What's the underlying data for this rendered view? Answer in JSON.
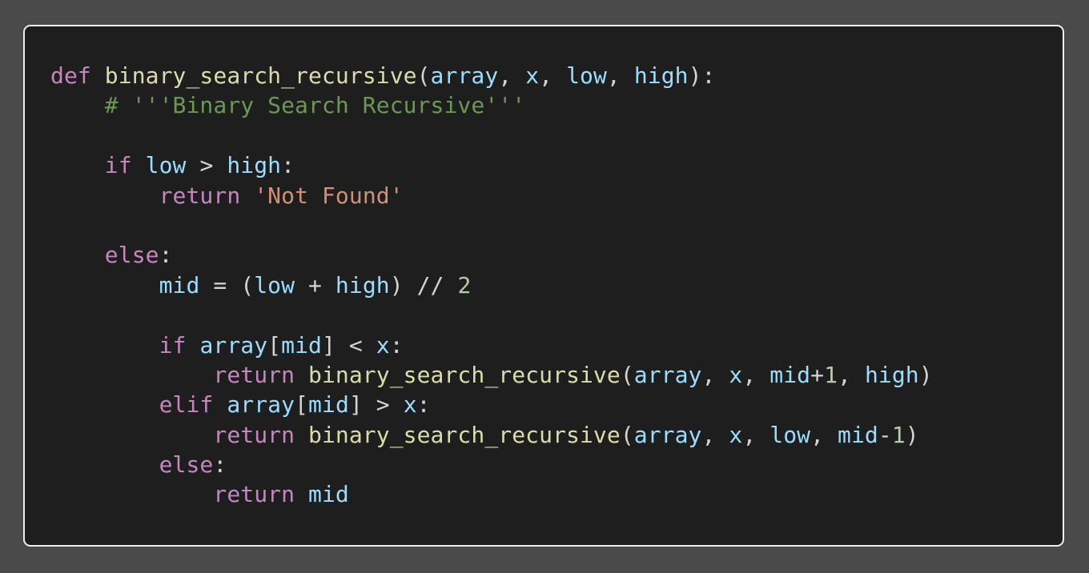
{
  "code": {
    "language": "python",
    "lines": [
      [
        [
          "kw",
          "def"
        ],
        [
          "pn",
          " "
        ],
        [
          "fn",
          "binary_search_recursive"
        ],
        [
          "pn",
          "("
        ],
        [
          "var",
          "array"
        ],
        [
          "pn",
          ", "
        ],
        [
          "var",
          "x"
        ],
        [
          "pn",
          ", "
        ],
        [
          "var",
          "low"
        ],
        [
          "pn",
          ", "
        ],
        [
          "var",
          "high"
        ],
        [
          "pn",
          "):"
        ]
      ],
      [
        [
          "pn",
          "    "
        ],
        [
          "cm",
          "# '''Binary Search Recursive'''"
        ]
      ],
      [],
      [
        [
          "pn",
          "    "
        ],
        [
          "kw",
          "if"
        ],
        [
          "pn",
          " "
        ],
        [
          "var",
          "low"
        ],
        [
          "pn",
          " > "
        ],
        [
          "var",
          "high"
        ],
        [
          "pn",
          ":"
        ]
      ],
      [
        [
          "pn",
          "        "
        ],
        [
          "kw",
          "return"
        ],
        [
          "pn",
          " "
        ],
        [
          "str",
          "'Not Found'"
        ]
      ],
      [],
      [
        [
          "pn",
          "    "
        ],
        [
          "kw",
          "else"
        ],
        [
          "pn",
          ":"
        ]
      ],
      [
        [
          "pn",
          "        "
        ],
        [
          "var",
          "mid"
        ],
        [
          "pn",
          " = ("
        ],
        [
          "var",
          "low"
        ],
        [
          "pn",
          " + "
        ],
        [
          "var",
          "high"
        ],
        [
          "pn",
          ") // "
        ],
        [
          "num",
          "2"
        ]
      ],
      [],
      [
        [
          "pn",
          "        "
        ],
        [
          "kw",
          "if"
        ],
        [
          "pn",
          " "
        ],
        [
          "var",
          "array"
        ],
        [
          "pn",
          "["
        ],
        [
          "var",
          "mid"
        ],
        [
          "pn",
          "] < "
        ],
        [
          "var",
          "x"
        ],
        [
          "pn",
          ":"
        ]
      ],
      [
        [
          "pn",
          "            "
        ],
        [
          "kw",
          "return"
        ],
        [
          "pn",
          " "
        ],
        [
          "fn",
          "binary_search_recursive"
        ],
        [
          "pn",
          "("
        ],
        [
          "var",
          "array"
        ],
        [
          "pn",
          ", "
        ],
        [
          "var",
          "x"
        ],
        [
          "pn",
          ", "
        ],
        [
          "var",
          "mid"
        ],
        [
          "pn",
          "+"
        ],
        [
          "num",
          "1"
        ],
        [
          "pn",
          ", "
        ],
        [
          "var",
          "high"
        ],
        [
          "pn",
          ")"
        ]
      ],
      [
        [
          "pn",
          "        "
        ],
        [
          "kw",
          "elif"
        ],
        [
          "pn",
          " "
        ],
        [
          "var",
          "array"
        ],
        [
          "pn",
          "["
        ],
        [
          "var",
          "mid"
        ],
        [
          "pn",
          "] > "
        ],
        [
          "var",
          "x"
        ],
        [
          "pn",
          ":"
        ]
      ],
      [
        [
          "pn",
          "            "
        ],
        [
          "kw",
          "return"
        ],
        [
          "pn",
          " "
        ],
        [
          "fn",
          "binary_search_recursive"
        ],
        [
          "pn",
          "("
        ],
        [
          "var",
          "array"
        ],
        [
          "pn",
          ", "
        ],
        [
          "var",
          "x"
        ],
        [
          "pn",
          ", "
        ],
        [
          "var",
          "low"
        ],
        [
          "pn",
          ", "
        ],
        [
          "var",
          "mid"
        ],
        [
          "pn",
          "-"
        ],
        [
          "num",
          "1"
        ],
        [
          "pn",
          ")"
        ]
      ],
      [
        [
          "pn",
          "        "
        ],
        [
          "kw",
          "else"
        ],
        [
          "pn",
          ":"
        ]
      ],
      [
        [
          "pn",
          "            "
        ],
        [
          "kw",
          "return"
        ],
        [
          "pn",
          " "
        ],
        [
          "var",
          "mid"
        ]
      ]
    ]
  },
  "token_names": {
    "kw": "keyword-token",
    "fn": "function-name-token",
    "var": "identifier-token",
    "cm": "comment-token",
    "str": "string-token",
    "num": "number-token",
    "pn": "punctuation-token"
  },
  "colors": {
    "background": "#4a4a4a",
    "editor": "#1e1e1e",
    "border": "#eeeeee",
    "keyword": "#c586c0",
    "function": "#dcdcaa",
    "identifier": "#9cdcfe",
    "comment": "#6a9955",
    "string": "#ce9178",
    "number": "#b5cea8",
    "punctuation": "#d4d4d4"
  }
}
